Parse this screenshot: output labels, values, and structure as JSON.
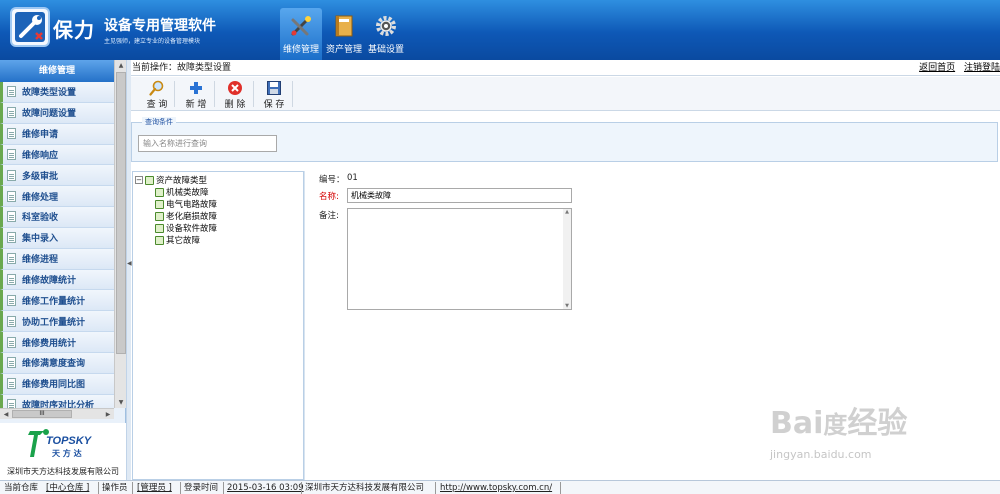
{
  "header": {
    "brand": "保力",
    "title": "设备专用管理软件",
    "subtitle": "主见强师，建立专业的设备管理模块",
    "nav": [
      {
        "label": "维修管理",
        "icon": "tools-icon",
        "active": true
      },
      {
        "label": "资产管理",
        "icon": "book-icon",
        "active": false
      },
      {
        "label": "基础设置",
        "icon": "gear-icon",
        "active": false
      }
    ]
  },
  "sidebar": {
    "title": "维修管理",
    "items": [
      {
        "label": "故障类型设置"
      },
      {
        "label": "故障问题设置"
      },
      {
        "label": "维修申请"
      },
      {
        "label": "维修响应"
      },
      {
        "label": "多级审批"
      },
      {
        "label": "维修处理"
      },
      {
        "label": "科室验收"
      },
      {
        "label": "集中录入"
      },
      {
        "label": "维修进程"
      },
      {
        "label": "维修故障统计"
      },
      {
        "label": "维修工作量统计"
      },
      {
        "label": "协助工作量统计"
      },
      {
        "label": "维修费用统计"
      },
      {
        "label": "维修满意度查询"
      },
      {
        "label": "维修费用同比图"
      },
      {
        "label": "故障时序对比分析"
      }
    ],
    "hscroll_label": "III",
    "company_logo_text": "TOPSKY",
    "company_logo_cn": "天 方 达",
    "company": "深圳市天方达科技发展有限公司"
  },
  "breadcrumb": {
    "label": "当前操作：故障类型设置",
    "links": [
      "返回首页",
      "注销登陆"
    ]
  },
  "toolbar": {
    "buttons": [
      {
        "label": "查 询",
        "icon": "search-icon"
      },
      {
        "label": "新 增",
        "icon": "add-icon"
      },
      {
        "label": "删 除",
        "icon": "delete-icon"
      },
      {
        "label": "保 存",
        "icon": "save-icon"
      }
    ]
  },
  "query": {
    "legend": "查询条件",
    "placeholder": "输入名称进行查询"
  },
  "tree": {
    "root": "资产故障类型",
    "children": [
      "机械类故障",
      "电气电路故障",
      "老化磨损故障",
      "设备软件故障",
      "其它故障"
    ]
  },
  "form": {
    "code_label": "编号：",
    "code_value": "01",
    "name_label": "名称:",
    "name_value": "机械类故障",
    "remark_label": "备注:",
    "remark_value": ""
  },
  "status": {
    "warehouse_label": "当前仓库",
    "warehouse_value": "[中心仓库 ]",
    "operator_label": "操作员",
    "operator_value": "[管理员 ]",
    "login_label": "登录时间",
    "login_value": "2015-03-16 03:09",
    "company": "深圳市天方达科技发展有限公司",
    "url": "http://www.topsky.com.cn/"
  },
  "colors": {
    "header_top": "#2f8fe0",
    "header_bottom": "#0a4aa0",
    "sidebar_accent": "#6aa84f",
    "required_label": "#d40000"
  }
}
